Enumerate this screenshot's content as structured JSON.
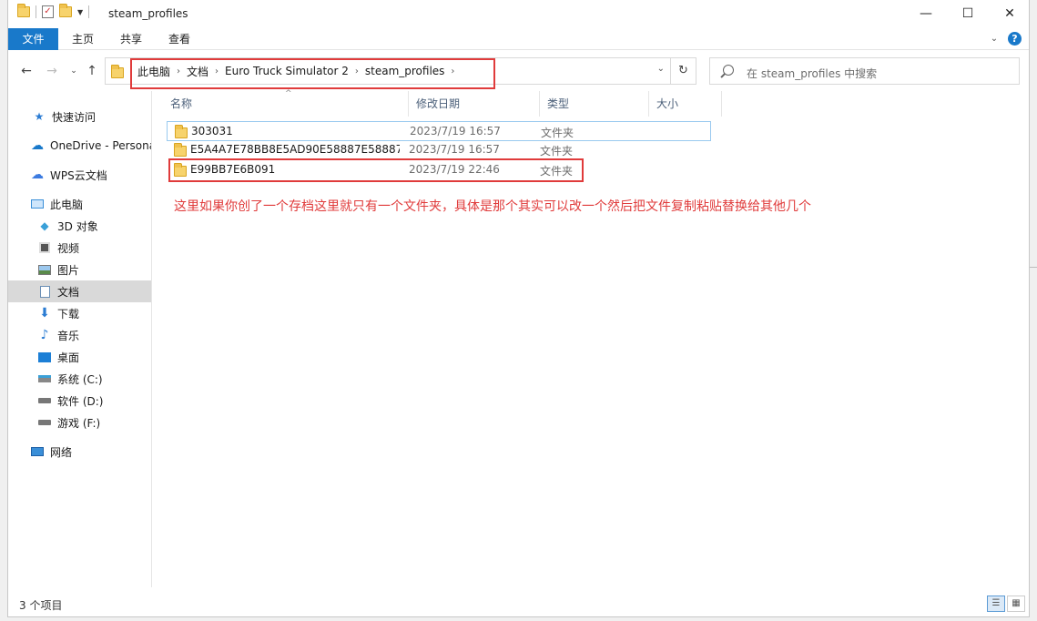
{
  "window": {
    "title": "steam_profiles",
    "controls": {
      "minimize": "—",
      "maximize": "☐",
      "close": "✕"
    }
  },
  "ribbon": {
    "tabs": [
      "文件",
      "主页",
      "共享",
      "查看"
    ],
    "help": "?"
  },
  "address": {
    "crumbs": [
      "此电脑",
      "文档",
      "Euro Truck Simulator 2",
      "steam_profiles"
    ]
  },
  "search": {
    "placeholder": "在 steam_profiles 中搜索"
  },
  "sidebar": {
    "items": [
      {
        "label": "快速访问",
        "icon": "star-icon"
      },
      {
        "label": "OneDrive - Personal",
        "icon": "cloud-icon"
      },
      {
        "label": "WPS云文档",
        "icon": "wps-cloud-icon"
      },
      {
        "label": "此电脑",
        "icon": "pc-icon"
      },
      {
        "label": "3D 对象",
        "icon": "cube-icon"
      },
      {
        "label": "视频",
        "icon": "video-icon"
      },
      {
        "label": "图片",
        "icon": "picture-icon"
      },
      {
        "label": "文档",
        "icon": "document-icon",
        "selected": true
      },
      {
        "label": "下载",
        "icon": "download-icon"
      },
      {
        "label": "音乐",
        "icon": "music-icon"
      },
      {
        "label": "桌面",
        "icon": "desktop-icon"
      },
      {
        "label": "系统 (C:)",
        "icon": "system-drive-icon"
      },
      {
        "label": "软件 (D:)",
        "icon": "drive-icon"
      },
      {
        "label": "游戏 (F:)",
        "icon": "drive-icon"
      },
      {
        "label": "网络",
        "icon": "network-icon"
      }
    ]
  },
  "columns": [
    "名称",
    "修改日期",
    "类型",
    "大小"
  ],
  "files": [
    {
      "name": "303031",
      "date": "2023/7/19 16:57",
      "type": "文件夹"
    },
    {
      "name": "E5A4A7E78BB8E5AD90E58887E58887...",
      "date": "2023/7/19 16:57",
      "type": "文件夹"
    },
    {
      "name": "E99BB7E6B091",
      "date": "2023/7/19 22:46",
      "type": "文件夹"
    }
  ],
  "annotation": "这里如果你创了一个存档这里就只有一个文件夹，具体是那个其实可以改一个然后把文件复制粘贴替换给其他几个",
  "status": {
    "count": "3 个项目"
  },
  "colors": {
    "accent": "#1979ca",
    "annotation": "#e03b3b"
  }
}
